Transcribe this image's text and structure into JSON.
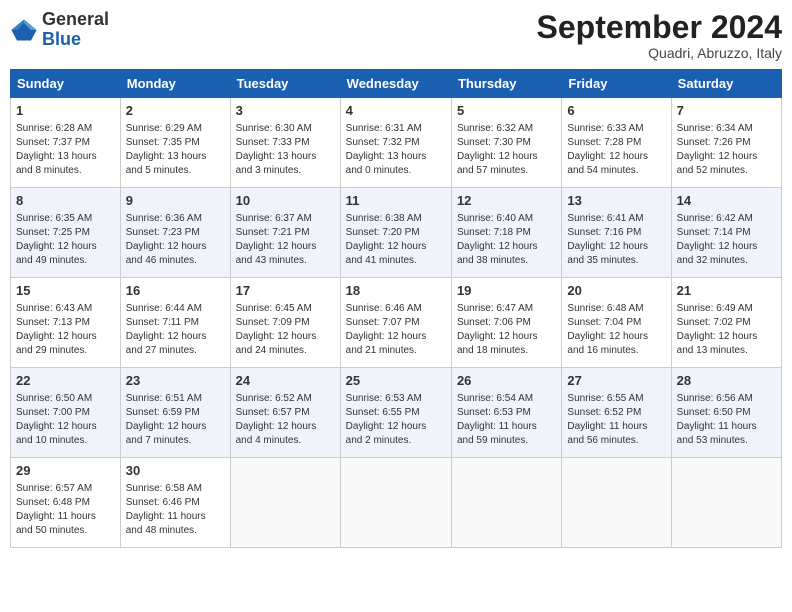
{
  "header": {
    "logo_general": "General",
    "logo_blue": "Blue",
    "month_title": "September 2024",
    "subtitle": "Quadri, Abruzzo, Italy"
  },
  "days_of_week": [
    "Sunday",
    "Monday",
    "Tuesday",
    "Wednesday",
    "Thursday",
    "Friday",
    "Saturday"
  ],
  "weeks": [
    [
      {
        "day": "1",
        "info": "Sunrise: 6:28 AM\nSunset: 7:37 PM\nDaylight: 13 hours\nand 8 minutes."
      },
      {
        "day": "2",
        "info": "Sunrise: 6:29 AM\nSunset: 7:35 PM\nDaylight: 13 hours\nand 5 minutes."
      },
      {
        "day": "3",
        "info": "Sunrise: 6:30 AM\nSunset: 7:33 PM\nDaylight: 13 hours\nand 3 minutes."
      },
      {
        "day": "4",
        "info": "Sunrise: 6:31 AM\nSunset: 7:32 PM\nDaylight: 13 hours\nand 0 minutes."
      },
      {
        "day": "5",
        "info": "Sunrise: 6:32 AM\nSunset: 7:30 PM\nDaylight: 12 hours\nand 57 minutes."
      },
      {
        "day": "6",
        "info": "Sunrise: 6:33 AM\nSunset: 7:28 PM\nDaylight: 12 hours\nand 54 minutes."
      },
      {
        "day": "7",
        "info": "Sunrise: 6:34 AM\nSunset: 7:26 PM\nDaylight: 12 hours\nand 52 minutes."
      }
    ],
    [
      {
        "day": "8",
        "info": "Sunrise: 6:35 AM\nSunset: 7:25 PM\nDaylight: 12 hours\nand 49 minutes."
      },
      {
        "day": "9",
        "info": "Sunrise: 6:36 AM\nSunset: 7:23 PM\nDaylight: 12 hours\nand 46 minutes."
      },
      {
        "day": "10",
        "info": "Sunrise: 6:37 AM\nSunset: 7:21 PM\nDaylight: 12 hours\nand 43 minutes."
      },
      {
        "day": "11",
        "info": "Sunrise: 6:38 AM\nSunset: 7:20 PM\nDaylight: 12 hours\nand 41 minutes."
      },
      {
        "day": "12",
        "info": "Sunrise: 6:40 AM\nSunset: 7:18 PM\nDaylight: 12 hours\nand 38 minutes."
      },
      {
        "day": "13",
        "info": "Sunrise: 6:41 AM\nSunset: 7:16 PM\nDaylight: 12 hours\nand 35 minutes."
      },
      {
        "day": "14",
        "info": "Sunrise: 6:42 AM\nSunset: 7:14 PM\nDaylight: 12 hours\nand 32 minutes."
      }
    ],
    [
      {
        "day": "15",
        "info": "Sunrise: 6:43 AM\nSunset: 7:13 PM\nDaylight: 12 hours\nand 29 minutes."
      },
      {
        "day": "16",
        "info": "Sunrise: 6:44 AM\nSunset: 7:11 PM\nDaylight: 12 hours\nand 27 minutes."
      },
      {
        "day": "17",
        "info": "Sunrise: 6:45 AM\nSunset: 7:09 PM\nDaylight: 12 hours\nand 24 minutes."
      },
      {
        "day": "18",
        "info": "Sunrise: 6:46 AM\nSunset: 7:07 PM\nDaylight: 12 hours\nand 21 minutes."
      },
      {
        "day": "19",
        "info": "Sunrise: 6:47 AM\nSunset: 7:06 PM\nDaylight: 12 hours\nand 18 minutes."
      },
      {
        "day": "20",
        "info": "Sunrise: 6:48 AM\nSunset: 7:04 PM\nDaylight: 12 hours\nand 16 minutes."
      },
      {
        "day": "21",
        "info": "Sunrise: 6:49 AM\nSunset: 7:02 PM\nDaylight: 12 hours\nand 13 minutes."
      }
    ],
    [
      {
        "day": "22",
        "info": "Sunrise: 6:50 AM\nSunset: 7:00 PM\nDaylight: 12 hours\nand 10 minutes."
      },
      {
        "day": "23",
        "info": "Sunrise: 6:51 AM\nSunset: 6:59 PM\nDaylight: 12 hours\nand 7 minutes."
      },
      {
        "day": "24",
        "info": "Sunrise: 6:52 AM\nSunset: 6:57 PM\nDaylight: 12 hours\nand 4 minutes."
      },
      {
        "day": "25",
        "info": "Sunrise: 6:53 AM\nSunset: 6:55 PM\nDaylight: 12 hours\nand 2 minutes."
      },
      {
        "day": "26",
        "info": "Sunrise: 6:54 AM\nSunset: 6:53 PM\nDaylight: 11 hours\nand 59 minutes."
      },
      {
        "day": "27",
        "info": "Sunrise: 6:55 AM\nSunset: 6:52 PM\nDaylight: 11 hours\nand 56 minutes."
      },
      {
        "day": "28",
        "info": "Sunrise: 6:56 AM\nSunset: 6:50 PM\nDaylight: 11 hours\nand 53 minutes."
      }
    ],
    [
      {
        "day": "29",
        "info": "Sunrise: 6:57 AM\nSunset: 6:48 PM\nDaylight: 11 hours\nand 50 minutes."
      },
      {
        "day": "30",
        "info": "Sunrise: 6:58 AM\nSunset: 6:46 PM\nDaylight: 11 hours\nand 48 minutes."
      },
      {
        "day": "",
        "info": ""
      },
      {
        "day": "",
        "info": ""
      },
      {
        "day": "",
        "info": ""
      },
      {
        "day": "",
        "info": ""
      },
      {
        "day": "",
        "info": ""
      }
    ]
  ]
}
